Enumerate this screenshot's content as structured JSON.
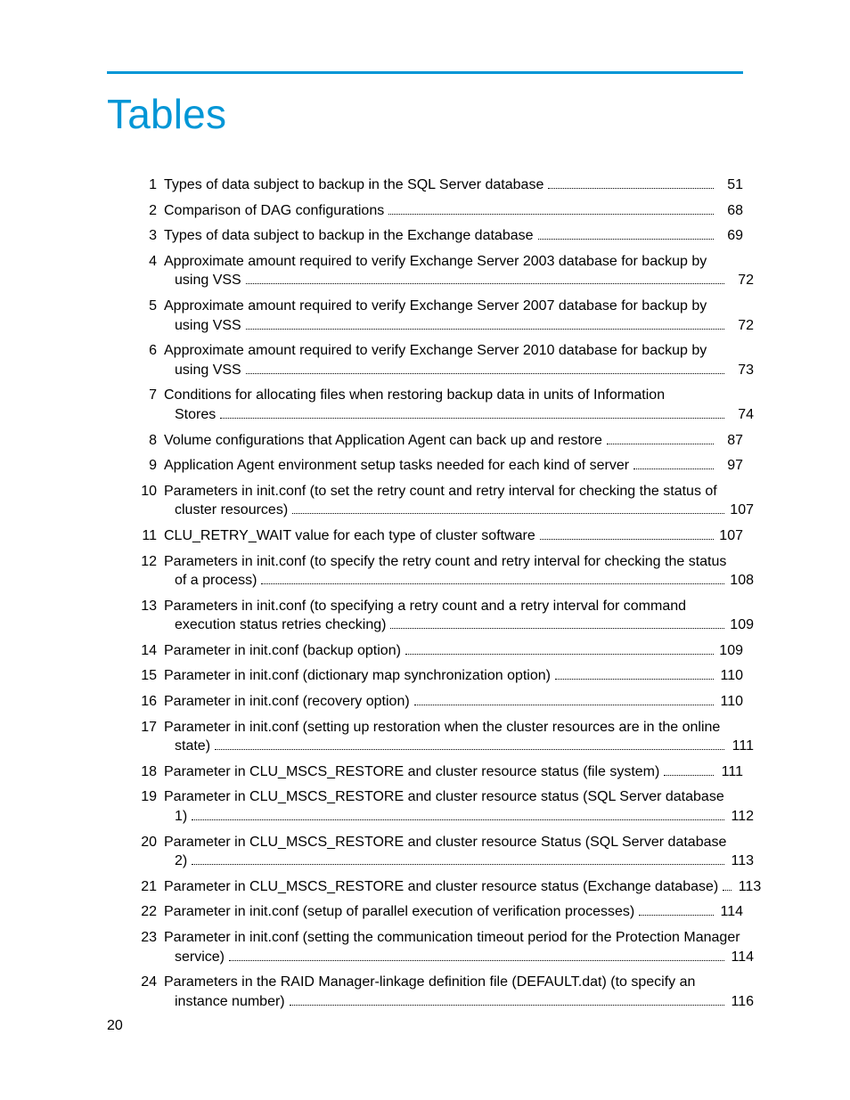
{
  "title": "Tables",
  "page_number": "20",
  "entries": [
    {
      "n": "1",
      "lines": [
        "Types of data subject to backup in the SQL Server database"
      ],
      "pg": "51"
    },
    {
      "n": "2",
      "lines": [
        "Comparison of DAG configurations"
      ],
      "pg": "68"
    },
    {
      "n": "3",
      "lines": [
        "Types of data subject to backup in the Exchange database"
      ],
      "pg": "69"
    },
    {
      "n": "4",
      "lines": [
        "Approximate amount required to verify Exchange Server 2003 database for backup by",
        "using VSS"
      ],
      "pg": "72"
    },
    {
      "n": "5",
      "lines": [
        "Approximate amount required to verify Exchange Server 2007 database for backup by",
        "using VSS"
      ],
      "pg": "72"
    },
    {
      "n": "6",
      "lines": [
        "Approximate amount required to verify Exchange Server 2010 database for backup by",
        "using VSS"
      ],
      "pg": "73"
    },
    {
      "n": "7",
      "lines": [
        "Conditions for allocating files when restoring backup data in units of Information",
        "Stores"
      ],
      "pg": "74"
    },
    {
      "n": "8",
      "lines": [
        "Volume configurations that Application Agent can back up and restore"
      ],
      "pg": "87"
    },
    {
      "n": "9",
      "lines": [
        "Application Agent environment setup tasks needed for each kind of server"
      ],
      "pg": "97"
    },
    {
      "n": "10",
      "lines": [
        "Parameters in init.conf (to set the retry count and retry interval for checking the status of",
        "cluster resources)"
      ],
      "pg": "107"
    },
    {
      "n": "11",
      "lines": [
        "CLU_RETRY_WAIT value for each type of cluster software"
      ],
      "pg": "107"
    },
    {
      "n": "12",
      "lines": [
        "Parameters in init.conf (to specify the retry count and retry interval for checking the status",
        "of a process)"
      ],
      "pg": "108"
    },
    {
      "n": "13",
      "lines": [
        "Parameters in init.conf (to specifying a retry count and a retry interval for command",
        "execution status retries checking)"
      ],
      "pg": "109"
    },
    {
      "n": "14",
      "lines": [
        "Parameter in init.conf (backup option)"
      ],
      "pg": "109"
    },
    {
      "n": "15",
      "lines": [
        "Parameter in init.conf (dictionary map synchronization option)"
      ],
      "pg": "110"
    },
    {
      "n": "16",
      "lines": [
        "Parameter in init.conf (recovery option)"
      ],
      "pg": "110"
    },
    {
      "n": "17",
      "lines": [
        "Parameter in init.conf (setting up restoration when the cluster resources are in the online",
        "state)"
      ],
      "pg": "111"
    },
    {
      "n": "18",
      "lines": [
        "Parameter in CLU_MSCS_RESTORE and cluster resource status (file system)"
      ],
      "pg": "111"
    },
    {
      "n": "19",
      "lines": [
        "Parameter in CLU_MSCS_RESTORE and cluster resource status (SQL Server database",
        "1)"
      ],
      "pg": "112"
    },
    {
      "n": "20",
      "lines": [
        "Parameter in CLU_MSCS_RESTORE and cluster resource Status (SQL Server database",
        "2)"
      ],
      "pg": "113"
    },
    {
      "n": "21",
      "lines": [
        "Parameter in CLU_MSCS_RESTORE and cluster resource status (Exchange database)"
      ],
      "pg": "113"
    },
    {
      "n": "22",
      "lines": [
        "Parameter in init.conf (setup of parallel execution of verification processes)"
      ],
      "pg": "114"
    },
    {
      "n": "23",
      "lines": [
        "Parameter in init.conf (setting the communication timeout period for the Protection Manager",
        "service)"
      ],
      "pg": "114"
    },
    {
      "n": "24",
      "lines": [
        "Parameters in the RAID Manager-linkage definition file (DEFAULT.dat) (to specify an",
        "instance number)"
      ],
      "pg": "116"
    }
  ]
}
